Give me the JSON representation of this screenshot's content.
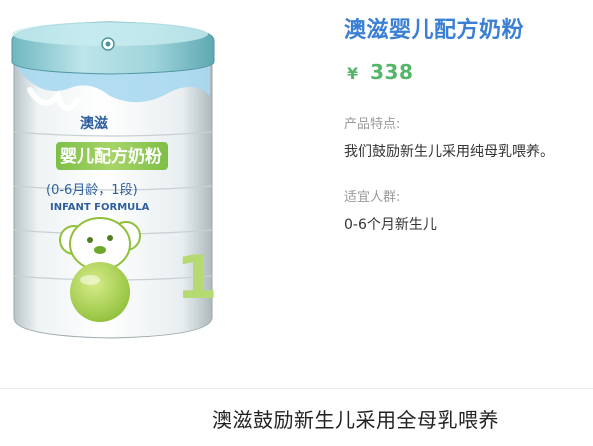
{
  "product": {
    "title": "澳滋婴儿配方奶粉",
    "price_symbol": "¥",
    "price": "338",
    "features_label": "产品特点:",
    "features_text": "我们鼓励新生儿采用纯母乳喂养。",
    "audience_label": "适宜人群:",
    "audience_text": "0-6个月新生儿"
  },
  "can": {
    "brand": "澳滋",
    "product_name": "婴儿配方奶粉",
    "stage": "(0-6月龄，1段)",
    "english_name": "INFANT FORMULA",
    "stage_number": "1"
  },
  "caption": "澳滋鼓励新生儿采用全母乳喂养"
}
